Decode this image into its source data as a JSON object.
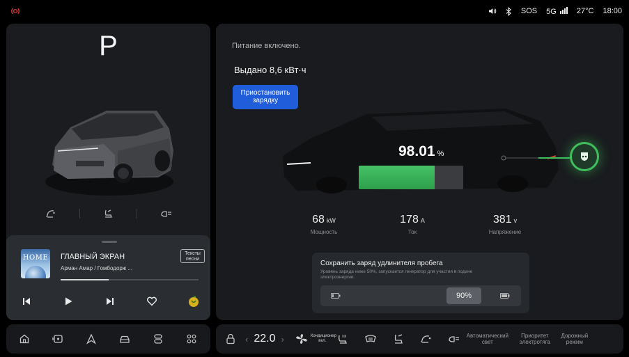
{
  "status_bar": {
    "sos": "SOS",
    "network": "5G",
    "temperature": "27°C",
    "time": "18:00",
    "left_icon": "signal-broadcast-icon"
  },
  "vehicle": {
    "gear": "P",
    "quick_controls": [
      "liftgate-icon",
      "seat-icon",
      "headlight-icon"
    ]
  },
  "music": {
    "album_art_text": "HOME",
    "title": "ГЛАВНЫЙ ЭКРАН",
    "artist": "Арман Амар / Гомбодорж ...",
    "lyrics_label": "Тексты песни",
    "progress": 0.35
  },
  "charging": {
    "status": "Питание включено.",
    "delivered": "Выдано 8,6 кВт·ч",
    "pause_button": "Приостановить зарядку",
    "battery_percent": "98.01",
    "battery_unit": "%",
    "battery_level": 0.9801,
    "accent": "#3fbf5c",
    "metrics": [
      {
        "value": "68",
        "unit": "kW",
        "label": "Мощность"
      },
      {
        "value": "178",
        "unit": "A",
        "label": "Ток"
      },
      {
        "value": "381",
        "unit": "v",
        "label": "Напряжение"
      }
    ]
  },
  "extender": {
    "title": "Сохранить заряд удлинителя пробега",
    "description": "Уровень заряда ниже 50%, запускается генератор для участия в подаче электроэнергии.",
    "value": "90%",
    "level": 0.9
  },
  "bottom_left": {
    "icons": [
      "home-icon",
      "media-icon",
      "navigation-icon",
      "car-icon",
      "seat-settings-icon",
      "apps-grid-icon"
    ]
  },
  "bottom_right": {
    "temperature": "22.0",
    "ac_label": "Кондиционер вкл.",
    "auto_light": "Автоматический свет",
    "electric_priority": "Приоритет электротяга",
    "road_mode": "Дорожный режим"
  },
  "colors": {
    "primary_button": "#1f5ddb",
    "panel": "#1c1e21",
    "battery_green": "#3fbf5c"
  }
}
